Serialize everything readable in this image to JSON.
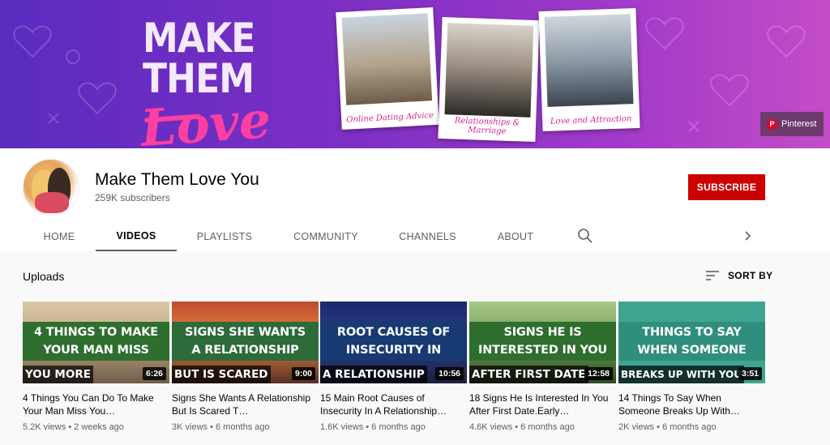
{
  "banner": {
    "title_line1": "MAKE THEM",
    "title_line2": "Love You",
    "polaroids": [
      {
        "caption": "Online Dating Advice"
      },
      {
        "caption": "Relationships & Marriage"
      },
      {
        "caption": "Love and Attraction"
      }
    ],
    "pinterest_label": "Pinterest"
  },
  "channel": {
    "name": "Make Them Love You",
    "subscribers": "259K subscribers",
    "subscribe_label": "SUBSCRIBE"
  },
  "tabs": [
    {
      "label": "HOME"
    },
    {
      "label": "VIDEOS"
    },
    {
      "label": "PLAYLISTS"
    },
    {
      "label": "COMMUNITY"
    },
    {
      "label": "CHANNELS"
    },
    {
      "label": "ABOUT"
    }
  ],
  "uploads": {
    "title": "Uploads",
    "sort_label": "SORT BY",
    "videos": [
      {
        "thumb_line1": "4 THINGS TO MAKE",
        "thumb_line2": "YOUR MAN MISS",
        "thumb_bottom": "YOU MORE",
        "duration": "6:26",
        "title": "4 Things You Can Do To Make Your Man Miss You…",
        "meta": "5.2K views • 2 weeks ago"
      },
      {
        "thumb_line1": "SIGNS SHE WANTS",
        "thumb_line2": "A RELATIONSHIP",
        "thumb_bottom": "BUT IS SCARED",
        "duration": "9:00",
        "title": "Signs She Wants A Relationship But Is Scared T…",
        "meta": "3K views • 6 months ago"
      },
      {
        "thumb_line1": "ROOT CAUSES OF",
        "thumb_line2": "INSECURITY IN",
        "thumb_bottom": "A RELATIONSHIP",
        "duration": "10:56",
        "title": "15 Main Root Causes of Insecurity In A Relationship…",
        "meta": "1.6K views • 6 months ago"
      },
      {
        "thumb_line1": "SIGNS HE IS",
        "thumb_line2": "INTERESTED IN YOU",
        "thumb_bottom": "AFTER FIRST DATE",
        "duration": "12:58",
        "title": "18 Signs He Is Interested In You After First Date.Early…",
        "meta": "4.6K views • 6 months ago"
      },
      {
        "thumb_line1": "THINGS TO SAY",
        "thumb_line2": "WHEN SOMEONE",
        "thumb_bottom": "BREAKS UP WITH YOU",
        "duration": "3:51",
        "title": "14 Things To Say When Someone Breaks Up With…",
        "meta": "2K views • 6 months ago"
      }
    ]
  }
}
